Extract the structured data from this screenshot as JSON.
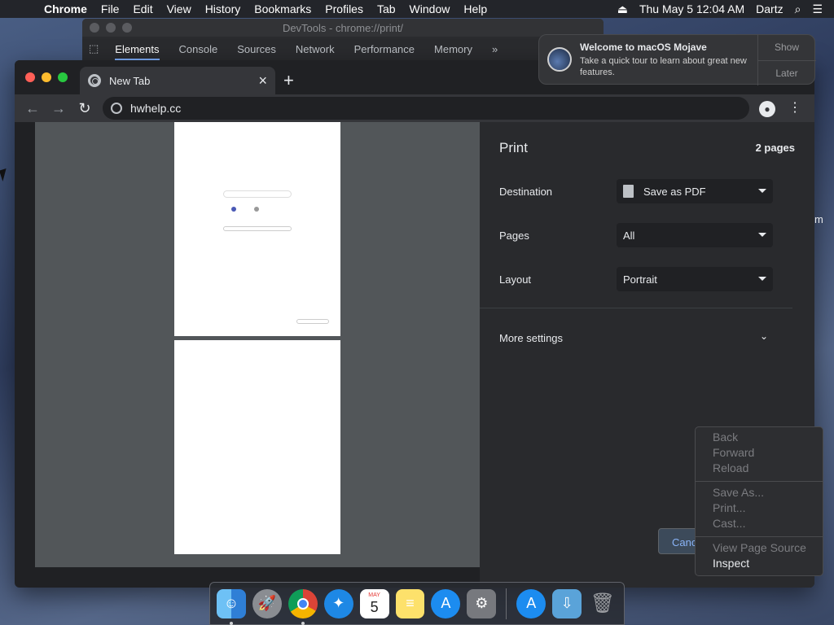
{
  "menubar": {
    "app_name": "Chrome",
    "items": [
      "File",
      "Edit",
      "View",
      "History",
      "Bookmarks",
      "Profiles",
      "Tab",
      "Window",
      "Help"
    ],
    "datetime": "Thu May 5  12:04 AM",
    "user": "Dartz"
  },
  "devtools": {
    "title": "DevTools - chrome://print/",
    "tabs": [
      "Elements",
      "Console",
      "Sources",
      "Network",
      "Performance",
      "Memory",
      "»"
    ]
  },
  "browser": {
    "tab_title": "New Tab",
    "url": "hwhelp.cc"
  },
  "print": {
    "title": "Print",
    "page_count": "2 pages",
    "destination_label": "Destination",
    "destination_value": "Save as PDF",
    "pages_label": "Pages",
    "pages_value": "All",
    "layout_label": "Layout",
    "layout_value": "Portrait",
    "more_settings": "More settings",
    "cancel": "Cancel"
  },
  "notification": {
    "title": "Welcome to macOS Mojave",
    "body": "Take a quick tour to learn about great new features.",
    "show": "Show",
    "later": "Later"
  },
  "context_menu": {
    "items": [
      "Back",
      "Forward",
      "Reload",
      "Save As...",
      "Print...",
      "Cast...",
      "View Page Source",
      "Inspect"
    ]
  },
  "side_text": "m",
  "dock": {
    "calendar_month": "MAY",
    "calendar_day": "5"
  },
  "colors": {
    "accent": "#8ab4f8",
    "close": "#ff5f57",
    "minimize": "#febc2e",
    "zoom": "#28c840"
  }
}
